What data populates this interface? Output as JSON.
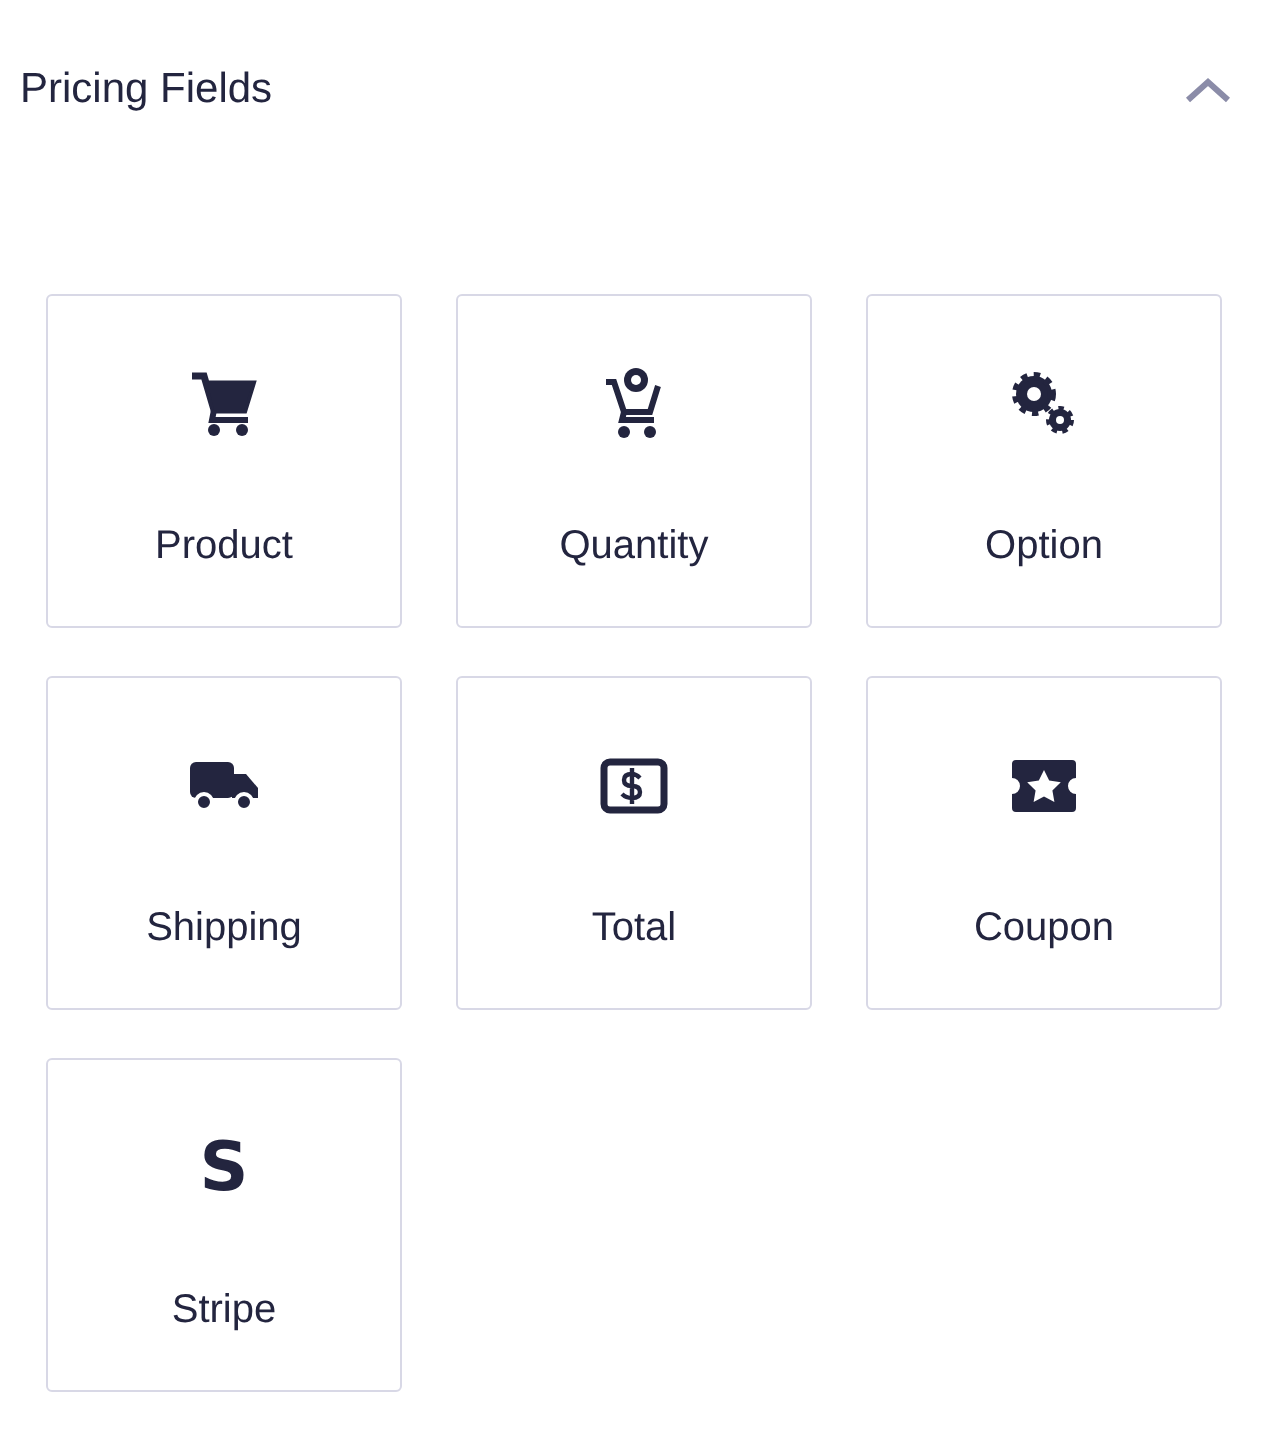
{
  "section": {
    "title": "Pricing Fields",
    "expanded": true
  },
  "fields": [
    {
      "kind": "cart",
      "label": "Product"
    },
    {
      "kind": "cart-count",
      "label": "Quantity"
    },
    {
      "kind": "gears",
      "label": "Option"
    },
    {
      "kind": "truck",
      "label": "Shipping"
    },
    {
      "kind": "money",
      "label": "Total"
    },
    {
      "kind": "ticket",
      "label": "Coupon"
    },
    {
      "kind": "glyph",
      "glyph": "S",
      "label": "Stripe"
    }
  ]
}
